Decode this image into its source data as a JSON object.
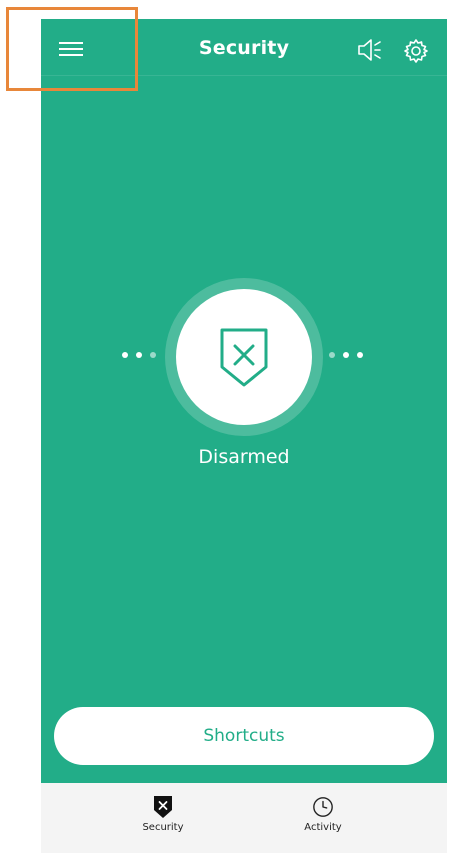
{
  "header": {
    "title": "Security",
    "menu_icon": "hamburger-menu-icon",
    "speaker_icon": "speaker-icon",
    "settings_icon": "gear-icon"
  },
  "main": {
    "status": "Disarmed",
    "status_icon": "shield-x-icon",
    "shortcuts_label": "Shortcuts"
  },
  "bottom_nav": {
    "items": [
      {
        "label": "Security",
        "icon": "shield-x-icon"
      },
      {
        "label": "Activity",
        "icon": "clock-icon"
      }
    ]
  },
  "colors": {
    "primary": "#22ad88",
    "ring": "#4dbc9e",
    "highlight": "#e8873a",
    "nav_background": "#f4f4f4"
  }
}
